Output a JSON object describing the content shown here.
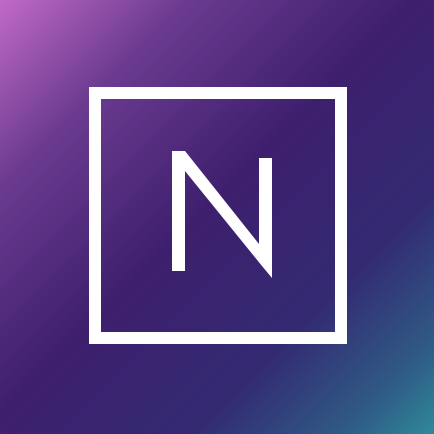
{
  "app": {
    "logo_letter": "N",
    "icon_name": "n-logo-icon"
  },
  "colors": {
    "gradient_start": "#c06ac6",
    "gradient_mid": "#3e1f6e",
    "gradient_end": "#2f8a9a",
    "mark": "#ffffff"
  }
}
